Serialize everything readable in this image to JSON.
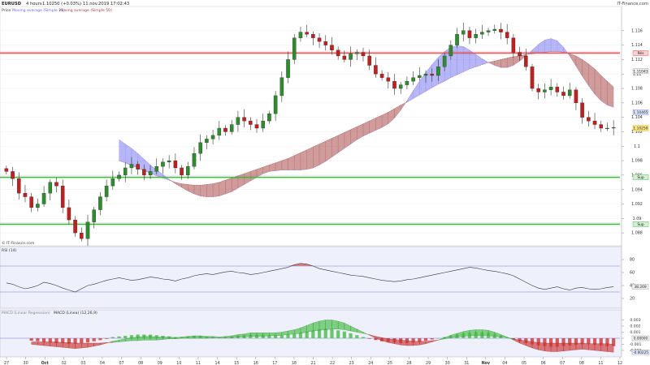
{
  "header": {
    "symbol": "EURUSD",
    "timeframe": "4 hours",
    "price_change": "1.10250 (+0.03%)",
    "datetime": "11.nov.2019 17:02:43",
    "brand": "IT-Finance.com",
    "legend_price": "Price",
    "legend_ma1": "Moving average (Simple 21)",
    "legend_ma2": "Moving average (Simple 50)",
    "watermark": "© IT-Finance.com"
  },
  "colors": {
    "bull": "#2e8b2e",
    "bear": "#c02020",
    "cloud_up": "#7b7bf0",
    "cloud_down": "#a84848",
    "resistance": "#e05050",
    "support": "#40b040",
    "rsi_line": "#333333",
    "macd_up": "#50c050",
    "macd_down": "#d04040",
    "panel_bg": "#eef0fb",
    "axis_label_bg": "#f0f0f0"
  },
  "chart_data": [
    {
      "type": "line",
      "panel": "price",
      "y_ticks": [
        "1.116",
        "1.114",
        "1.112",
        "1.11",
        "1.108",
        "1.106",
        "1.104",
        "1.102",
        "1.1",
        "1.098",
        "1.096",
        "1.094",
        "1.092",
        "1.09",
        "1.088"
      ],
      "ylim": [
        1.087,
        1.118
      ],
      "value_labels": [
        {
          "text": "Rés",
          "value": 1.1129
        },
        {
          "text": "1.11043",
          "value": 1.1104
        },
        {
          "text": "1.10465",
          "value": 1.1047
        },
        {
          "text": "1.10250",
          "value": 1.1025
        },
        {
          "text": "Sup",
          "value": 1.0957
        },
        {
          "text": "Sup",
          "value": 1.0892
        }
      ],
      "levels": [
        {
          "name": "Rés",
          "value": 1.1129
        },
        {
          "name": "Sup",
          "value": 1.0957
        },
        {
          "name": "Sup",
          "value": 1.0892
        }
      ],
      "close": [
        1.0965,
        1.0955,
        1.0935,
        1.093,
        1.0915,
        1.092,
        1.0935,
        1.095,
        1.0945,
        1.0915,
        1.0898,
        1.088,
        1.0872,
        1.0895,
        1.0912,
        1.093,
        1.0945,
        1.0955,
        1.096,
        1.097,
        1.0975,
        1.0968,
        1.096,
        1.0965,
        1.0972,
        1.0978,
        1.098,
        1.097,
        1.096,
        1.0972,
        1.099,
        1.1005,
        1.101,
        1.1015,
        1.1025,
        1.102,
        1.103,
        1.104,
        1.1035,
        1.103,
        1.1025,
        1.1035,
        1.1045,
        1.107,
        1.1095,
        1.112,
        1.115,
        1.1158,
        1.1155,
        1.115,
        1.1145,
        1.114,
        1.1133,
        1.1125,
        1.112,
        1.1128,
        1.113,
        1.1125,
        1.1112,
        1.11,
        1.1095,
        1.109,
        1.108,
        1.1085,
        1.109,
        1.1095,
        1.1098,
        1.11,
        1.1098,
        1.111,
        1.1125,
        1.114,
        1.1155,
        1.116,
        1.115,
        1.1155,
        1.1158,
        1.116,
        1.1162,
        1.1158,
        1.115,
        1.113,
        1.1125,
        1.111,
        1.108,
        1.1075,
        1.1078,
        1.1082,
        1.1075,
        1.107,
        1.1078,
        1.106,
        1.104,
        1.1035,
        1.103,
        1.1025,
        1.1025,
        1.1026
      ],
      "ma21": [
        1.1009,
        1.1003,
        1.0997,
        1.099,
        1.0982,
        1.0974,
        1.0967,
        1.0961,
        1.0954,
        1.0948,
        1.0943,
        1.0938,
        1.0934,
        1.0931,
        1.093,
        1.093,
        1.0931,
        1.0934,
        1.0937,
        1.0942,
        1.0947,
        1.0952,
        1.0957,
        1.0962,
        1.0965,
        1.0966,
        1.0967,
        1.0967,
        1.0967,
        1.0967,
        1.0968,
        1.097,
        1.0974,
        1.0979,
        1.0985,
        1.0991,
        1.0997,
        1.1003,
        1.1009,
        1.1014,
        1.1018,
        1.1022,
        1.1026,
        1.1031,
        1.1039,
        1.105,
        1.1063,
        1.1077,
        1.109,
        1.1102,
        1.1113,
        1.1123,
        1.1131,
        1.1137,
        1.1139,
        1.1138,
        1.1133,
        1.1127,
        1.1121,
        1.1116,
        1.1112,
        1.1109,
        1.1109,
        1.1112,
        1.1118,
        1.1125,
        1.1133,
        1.1141,
        1.1147,
        1.1149,
        1.1146,
        1.1137,
        1.1125,
        1.1111,
        1.1097,
        1.1084,
        1.1072,
        1.1063,
        1.1057,
        1.1054
      ],
      "ma50": [
        1.098,
        1.0977,
        1.0973,
        1.097,
        1.0966,
        1.0963,
        1.0959,
        1.0956,
        1.0953,
        1.095,
        1.0948,
        1.0947,
        1.0946,
        1.0946,
        1.0947,
        1.0948,
        1.095,
        1.0953,
        1.0956,
        1.0959,
        1.0962,
        1.0965,
        1.0968,
        1.0971,
        1.0974,
        1.0977,
        1.098,
        1.0983,
        1.0987,
        1.0991,
        1.0995,
        1.0999,
        1.1003,
        1.1007,
        1.1011,
        1.1015,
        1.1019,
        1.1023,
        1.1027,
        1.1031,
        1.1035,
        1.1039,
        1.1043,
        1.1047,
        1.1052,
        1.1057,
        1.1061,
        1.1066,
        1.1071,
        1.1076,
        1.1081,
        1.1086,
        1.109,
        1.1095,
        1.1099,
        1.1103,
        1.1107,
        1.111,
        1.1113,
        1.1116,
        1.1118,
        1.112,
        1.1122,
        1.1124,
        1.1125,
        1.1127,
        1.1128,
        1.1129,
        1.113,
        1.1131,
        1.1131,
        1.113,
        1.1128,
        1.1125,
        1.112,
        1.1114,
        1.1107,
        1.1098,
        1.109,
        1.1082
      ]
    },
    {
      "type": "line",
      "panel": "rsi",
      "legend": "RSI (14)",
      "y_ticks": [
        "80",
        "60",
        "40",
        "20"
      ],
      "ylim": [
        10,
        90
      ],
      "levels": [
        70,
        30
      ],
      "value_label": "38.269",
      "values": [
        44,
        42,
        38,
        35,
        37,
        40,
        45,
        43,
        40,
        36,
        33,
        30,
        35,
        40,
        42,
        45,
        48,
        50,
        52,
        50,
        48,
        49,
        51,
        53,
        52,
        50,
        49,
        47,
        50,
        52,
        55,
        57,
        58,
        57,
        59,
        61,
        62,
        60,
        59,
        57,
        58,
        60,
        62,
        64,
        66,
        68,
        72,
        74,
        73,
        70,
        66,
        64,
        62,
        60,
        58,
        56,
        55,
        54,
        52,
        50,
        48,
        47,
        46,
        47,
        49,
        50,
        52,
        54,
        56,
        58,
        60,
        62,
        64,
        66,
        68,
        67,
        65,
        63,
        62,
        60,
        58,
        55,
        50,
        45,
        40,
        36,
        34,
        36,
        38,
        35,
        33,
        36,
        37,
        35,
        34,
        35,
        37,
        38
      ]
    },
    {
      "type": "bar",
      "panel": "macd",
      "legend_prefix": "MACD (Linear Regression)",
      "legend": "MACD (Linea) (12,26,9)",
      "y_ticks": [
        "0.003",
        "0.002",
        "0.001",
        "0",
        "-0.001",
        "-0.002"
      ],
      "ylim": [
        -0.0028,
        0.0036
      ],
      "value_labels": [
        "0.00000",
        "-0.00225"
      ],
      "histogram": [
        -0.0004,
        -0.0005,
        -0.0006,
        -0.0007,
        -0.0008,
        -0.0008,
        -0.0009,
        -0.0009,
        -0.0008,
        -0.0007,
        -0.0005,
        -0.0003,
        -0.0001,
        0.0002,
        0.0003,
        0.0004,
        0.0005,
        0.0006,
        0.0006,
        0.0006,
        0.0005,
        0.0004,
        0.0003,
        0.0002,
        0.0002,
        0.0003,
        0.0004,
        0.0004,
        0.0003,
        0.0002,
        0.0001,
        0.0002,
        0.0003,
        0.0004,
        0.0005,
        0.0006,
        0.0006,
        0.0006,
        0.0005,
        0.0005,
        0.0005,
        0.0006,
        0.0007,
        0.0009,
        0.0011,
        0.0013,
        0.0015,
        0.0016,
        0.0015,
        0.0013,
        0.0011,
        0.0008,
        0.0005,
        0.0002,
        -0.0001,
        -0.0003,
        -0.0005,
        -0.0006,
        -0.0007,
        -0.0008,
        -0.0008,
        -0.0007,
        -0.0006,
        -0.0004,
        -0.0002,
        0.0,
        0.0002,
        0.0004,
        0.0006,
        0.0008,
        0.0009,
        0.001,
        0.001,
        0.0009,
        0.0007,
        0.0004,
        0.0001,
        -0.0002,
        -0.0005,
        -0.0008,
        -0.001,
        -0.0012,
        -0.0013,
        -0.0014,
        -0.0014,
        -0.0013,
        -0.0012,
        -0.0011,
        -0.001,
        -0.001,
        -0.0011,
        -0.0012,
        -0.0013,
        -0.0013
      ],
      "macd": [
        -0.001,
        -0.0011,
        -0.0012,
        -0.0013,
        -0.0014,
        -0.0015,
        -0.0016,
        -0.0017,
        -0.0016,
        -0.0015,
        -0.0013,
        -0.0011,
        -0.0008,
        -0.0005,
        -0.0003,
        -0.0001,
        0.0001,
        0.0002,
        0.0003,
        0.0003,
        0.0002,
        0.0002,
        0.0002,
        0.0001,
        0.0002,
        0.0003,
        0.0004,
        0.0004,
        0.0003,
        0.0003,
        0.0002,
        0.0003,
        0.0004,
        0.0006,
        0.0007,
        0.0009,
        0.0009,
        0.0009,
        0.0009,
        0.0009,
        0.001,
        0.0012,
        0.0014,
        0.0017,
        0.0021,
        0.0025,
        0.0028,
        0.003,
        0.003,
        0.0028,
        0.0025,
        0.002,
        0.0015,
        0.001,
        0.0005,
        0.0,
        -0.0004,
        -0.0007,
        -0.0009,
        -0.0011,
        -0.0012,
        -0.0012,
        -0.0011,
        -0.0009,
        -0.0006,
        -0.0003,
        0.0001,
        0.0005,
        0.0008,
        0.0011,
        0.0013,
        0.0014,
        0.0014,
        0.0013,
        0.001,
        0.0006,
        0.0002,
        -0.0003,
        -0.0008,
        -0.0012,
        -0.0016,
        -0.0019,
        -0.0021,
        -0.0022,
        -0.0022,
        -0.0021,
        -0.002,
        -0.0019,
        -0.0018,
        -0.0019,
        -0.002,
        -0.0021,
        -0.0022,
        -0.0023
      ]
    }
  ],
  "x_axis": {
    "labels": [
      "27",
      "30",
      "Oct",
      "02",
      "03",
      "04",
      "07",
      "08",
      "09",
      "10",
      "11",
      "14",
      "15",
      "16",
      "17",
      "18",
      "21",
      "22",
      "23",
      "24",
      "25",
      "28",
      "29",
      "30",
      "31",
      "Nov",
      "04",
      "05",
      "06",
      "07",
      "08",
      "11",
      "12"
    ],
    "bold": [
      "Oct",
      "Nov"
    ]
  }
}
